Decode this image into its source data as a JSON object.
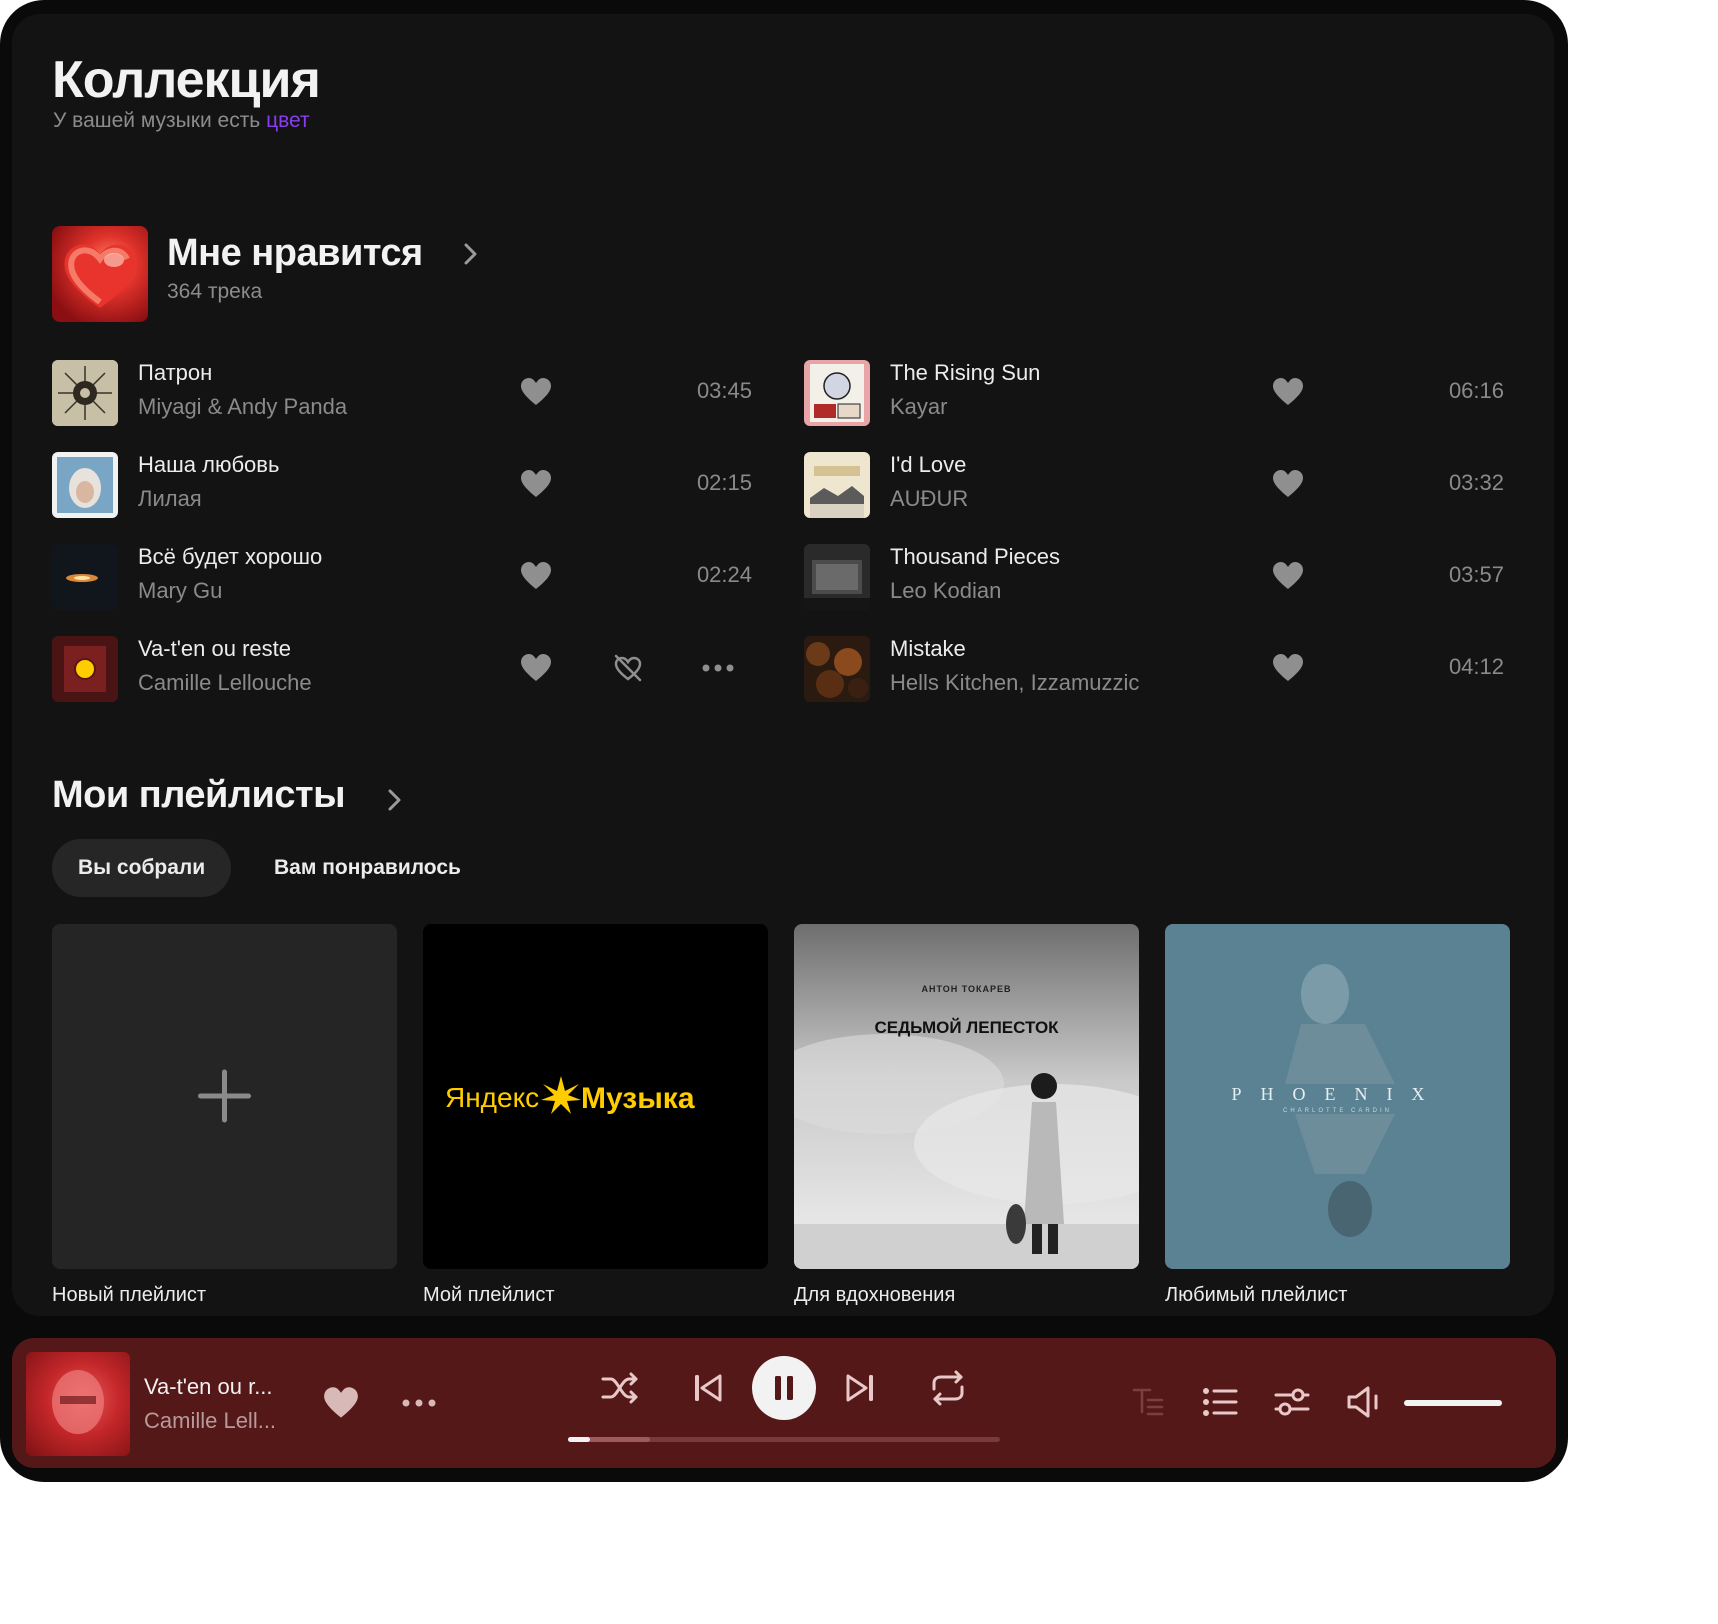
{
  "header": {
    "title": "Коллекция",
    "subtitle_prefix": "У вашей музыки есть ",
    "subtitle_accent": "цвет"
  },
  "liked": {
    "title": "Мне нравится",
    "count": "364 трека"
  },
  "tracks_left": [
    {
      "name": "Патрон",
      "artist": "Miyagi & Andy Panda",
      "duration": "03:45"
    },
    {
      "name": "Наша любовь",
      "artist": "Лилая",
      "duration": "02:15"
    },
    {
      "name": "Всё будет хорошо",
      "artist": "Mary Gu",
      "duration": "02:24"
    },
    {
      "name": "Va-t'en ou reste",
      "artist": "Camille Lellouche",
      "duration": ""
    }
  ],
  "tracks_right": [
    {
      "name": "The Rising Sun",
      "artist": "Kayar",
      "duration": "06:16"
    },
    {
      "name": "I'd Love",
      "artist": "AUÐUR",
      "duration": "03:32"
    },
    {
      "name": "Thousand Pieces",
      "artist": "Leo Kodian",
      "duration": "03:57"
    },
    {
      "name": "Mistake",
      "artist": "Hells Kitchen, Izzamuzzic",
      "duration": "04:12"
    }
  ],
  "playlists": {
    "title": "Мои плейлисты",
    "tabs": [
      "Вы собрали",
      "Вам понравилось"
    ],
    "active_tab": "Вы собрали",
    "items": [
      {
        "caption": "Новый плейлист"
      },
      {
        "caption": "Мой плейлист",
        "cover_text_left": "Яндекс",
        "cover_text_right": "Музыка"
      },
      {
        "caption": "Для вдохновения",
        "cover_artist": "АНТОН ТОКАРЕВ",
        "cover_title": "СЕДЬМОЙ ЛЕПЕСТОК"
      },
      {
        "caption": "Любимый плейлист",
        "cover_title": "PHOENIX",
        "cover_artist": "CHARLOTTE CARDIN"
      }
    ]
  },
  "player": {
    "title": "Va-t'en ou r...",
    "artist": "Camille Lell...",
    "progress": 0.05,
    "buffered": 0.19,
    "volume": 1.0,
    "state": "playing"
  },
  "colors": {
    "background": "#0a0a0a",
    "surface": "#131313",
    "accent": "#8a3cf0",
    "player": "#541818",
    "yandex_yellow": "#ffcc00"
  }
}
